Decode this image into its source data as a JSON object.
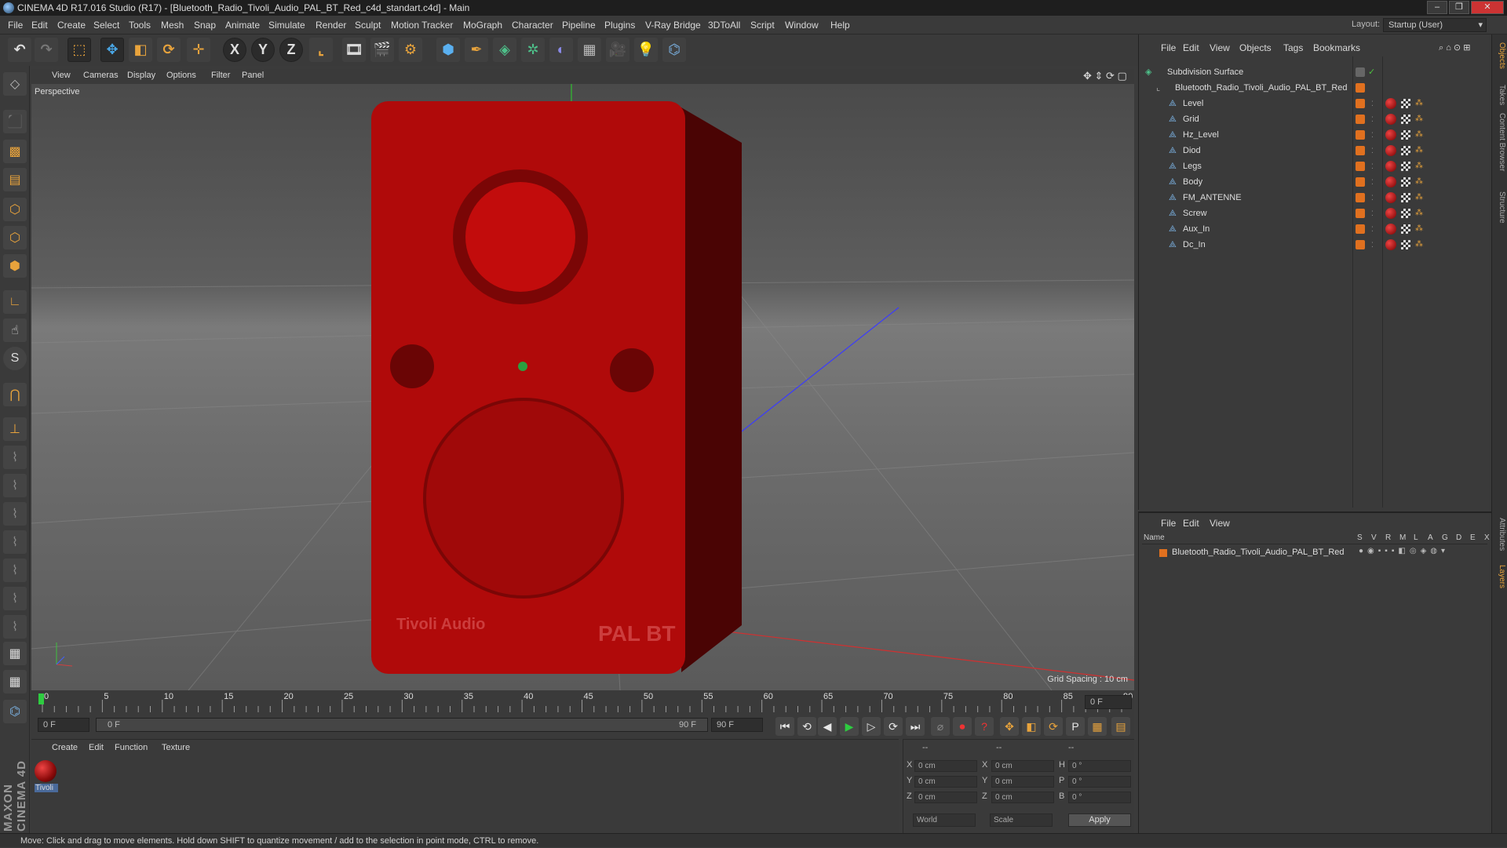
{
  "window": {
    "title": "CINEMA 4D R17.016 Studio (R17) - [Bluetooth_Radio_Tivoli_Audio_PAL_BT_Red_c4d_standart.c4d] - Main",
    "controls": [
      "–",
      "❐",
      "✕"
    ]
  },
  "menubar": {
    "items": [
      "File",
      "Edit",
      "Create",
      "Select",
      "Tools",
      "Mesh",
      "Snap",
      "Animate",
      "Simulate",
      "Render",
      "Sculpt",
      "Motion Tracker",
      "MoGraph",
      "Character",
      "Pipeline",
      "Plugins",
      "V-Ray Bridge",
      "3DToAll",
      "Script",
      "Window",
      "Help"
    ],
    "layout_label": "Layout:",
    "layout_value": "Startup (User)"
  },
  "toolbar": {
    "icons": [
      "undo-icon",
      "redo-icon",
      "live-selection-icon",
      "move-icon",
      "scale-icon",
      "rotate-icon",
      "transform-icon",
      "x-axis-icon",
      "y-axis-icon",
      "z-axis-icon",
      "world-coord-icon",
      "render-view-icon",
      "render-picture-viewer-icon",
      "render-settings-icon",
      "cube-icon",
      "pen-icon",
      "subdivision-icon",
      "cloner-icon",
      "deformer-icon",
      "floor-icon",
      "camera-icon",
      "light-icon",
      "python-icon"
    ],
    "axis_labels": [
      "X",
      "Y",
      "Z"
    ]
  },
  "viewport": {
    "menu": [
      "View",
      "Cameras",
      "Display",
      "Options",
      "Filter",
      "Panel"
    ],
    "label": "Perspective",
    "grid_spacing": "Grid Spacing : 10 cm",
    "radio_brand": "Tivoli Audio",
    "radio_model": "PAL BT"
  },
  "timeline": {
    "ticks": [
      "0",
      "5",
      "10",
      "15",
      "20",
      "25",
      "30",
      "35",
      "40",
      "45",
      "50",
      "55",
      "60",
      "65",
      "70",
      "75",
      "80",
      "85",
      "90"
    ],
    "current_frame": "0 F"
  },
  "playback": {
    "start_field": "0 F",
    "range_start": "0 F",
    "range_end": "90 F",
    "end_field": "90 F"
  },
  "materials": {
    "menu": [
      "Create",
      "Edit",
      "Function",
      "Texture"
    ],
    "items": [
      {
        "name": "Tivoli",
        "color": "#8b0a0a"
      }
    ]
  },
  "coordinates": {
    "header": [
      "--",
      "--",
      "--"
    ],
    "rows": [
      {
        "a_label": "X",
        "a_val": "0 cm",
        "b_label": "X",
        "b_val": "0 cm",
        "c_label": "H",
        "c_val": "0 °"
      },
      {
        "a_label": "Y",
        "a_val": "0 cm",
        "b_label": "Y",
        "b_val": "0 cm",
        "c_label": "P",
        "c_val": "0 °"
      },
      {
        "a_label": "Z",
        "a_val": "0 cm",
        "b_label": "Z",
        "b_val": "0 cm",
        "c_label": "B",
        "c_val": "0 °"
      }
    ],
    "mode": "World",
    "type": "Scale",
    "apply": "Apply"
  },
  "objects_panel": {
    "menu": [
      "File",
      "Edit",
      "View",
      "Objects",
      "Tags",
      "Bookmarks"
    ],
    "root": "Subdivision Surface",
    "group": "Bluetooth_Radio_Tivoli_Audio_PAL_BT_Red",
    "children": [
      "Level",
      "Grid",
      "Hz_Level",
      "Diod",
      "Legs",
      "Body",
      "FM_ANTENNE",
      "Screw",
      "Aux_In",
      "Dc_In"
    ]
  },
  "layers_panel": {
    "menu": [
      "File",
      "Edit",
      "View"
    ],
    "name_header": "Name",
    "columns": [
      "S",
      "V",
      "R",
      "M",
      "L",
      "A",
      "G",
      "D",
      "E",
      "X"
    ],
    "layer": "Bluetooth_Radio_Tivoli_Audio_PAL_BT_Red"
  },
  "right_tabs": [
    "Objects",
    "Takes",
    "Content Browser",
    "Structure",
    "Attributes",
    "Layers"
  ],
  "status": "Move: Click and drag to move elements. Hold down SHIFT to quantize movement / add to the selection in point mode, CTRL to remove.",
  "colors": {
    "accent": "#e8a33c",
    "radio_red": "#b00a0a",
    "layer_orange": "#e0701f"
  }
}
